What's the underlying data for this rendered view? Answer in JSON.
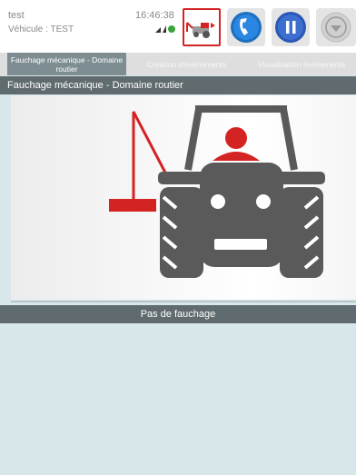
{
  "header": {
    "user": "test",
    "vehicle": "Véhicule : TEST",
    "time": "16:46:38",
    "icons": {
      "gps": "gps-signal-icon",
      "mowing": "mowing-mode-icon",
      "call": "phone-call-icon",
      "pause": "pause-icon",
      "menu": "dropdown-menu-icon"
    }
  },
  "tabs": [
    {
      "label": "Fauchage mécanique - Domaine routier",
      "active": true
    },
    {
      "label": "Création d'événements",
      "active": false
    },
    {
      "label": "Visualisation événements",
      "active": false
    }
  ],
  "section": {
    "title": "Fauchage mécanique - Domaine routier"
  },
  "status": {
    "label": "Pas de fauchage"
  },
  "colors": {
    "accent_red": "#d42323",
    "tractor_gray": "#5a5a5a",
    "bar": "#5f6b6e",
    "tab_active": "#7d8d91",
    "background": "#d7e7ea",
    "call_blue": "#1e6fc0",
    "pause_blue": "#2b57b6"
  }
}
